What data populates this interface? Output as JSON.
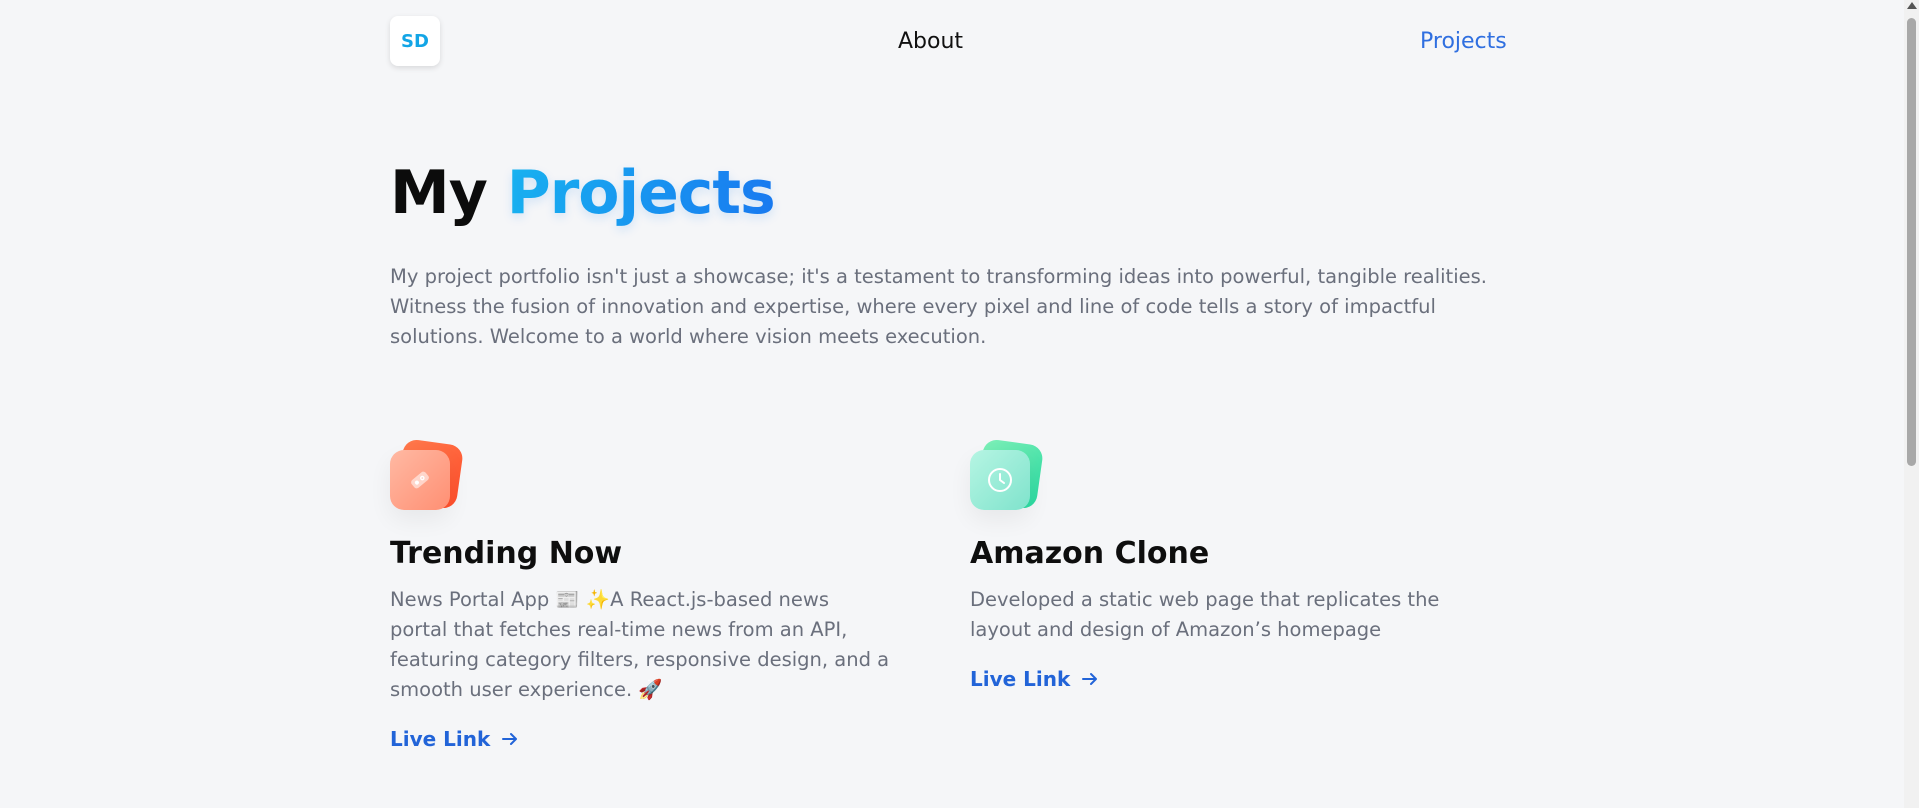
{
  "nav": {
    "logo_text": "SD",
    "about_label": "About",
    "projects_label": "Projects"
  },
  "hero": {
    "title_plain": "My",
    "title_accent": "Projects",
    "description": "My project portfolio isn't just a showcase; it's a testament to transforming ideas into powerful, tangible realities. Witness the fusion of innovation and expertise, where every pixel and line of code tells a story of impactful solutions. Welcome to a world where vision meets execution."
  },
  "projects": [
    {
      "title": "Trending Now",
      "description": "News Portal App 📰 ✨A React.js-based news portal that fetches real-time news from an API, featuring category filters, responsive design, and a smooth user experience. 🚀",
      "link_label": "Live Link",
      "icon": "tag-icon",
      "color": "#ff5a36"
    },
    {
      "title": "Amazon Clone",
      "description": "Developed a static web page that replicates the layout and design of Amazon’s homepage",
      "link_label": "Live Link",
      "icon": "clock-icon",
      "color": "#33d9a6"
    }
  ],
  "colors": {
    "accent": "#2264d8",
    "gradient_start": "#19b6f0",
    "gradient_end": "#1a7af0",
    "background": "#f5f6f8"
  }
}
